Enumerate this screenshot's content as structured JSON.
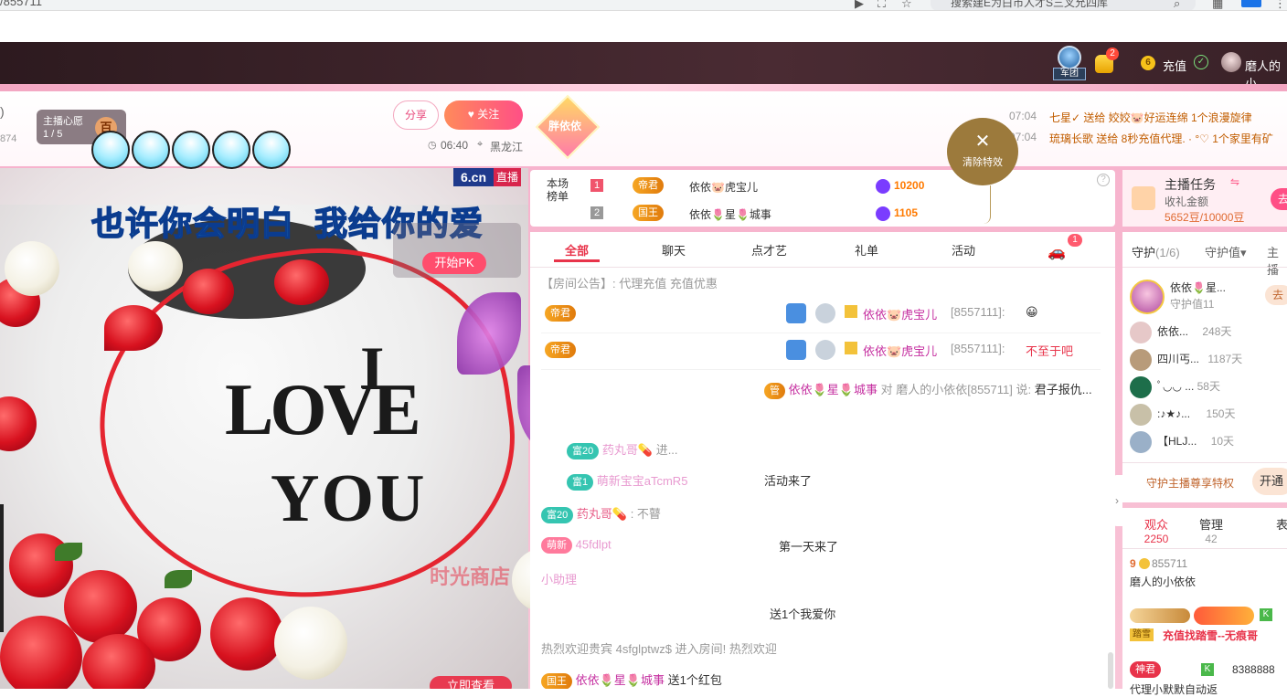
{
  "browser": {
    "url": "/855711",
    "tab_title": "搜索建E为白市人才S三叉允四库"
  },
  "header": {
    "legion_label": "军团",
    "notif_count": "2",
    "coin_icon_text": "6",
    "recharge_label": "充值",
    "user_name": "磨人的小"
  },
  "anchor": {
    "close_paren": ")",
    "fans": "874",
    "wish_label": "主播心愿",
    "wish_progress": "1 / 5",
    "wish_badge": "百"
  },
  "actions": {
    "share_label": "分享",
    "follow_label": "关注"
  },
  "live_meta": {
    "time": "06:40",
    "location": "黑龙江",
    "fan_badge": "胖依依"
  },
  "marquee": [
    {
      "time": "07:04",
      "text": "七星✓ 送给 姣姣🐷好运连绵 1个浪漫旋律"
    },
    {
      "time": "07:04",
      "text": "琉璃长歌 送给 8秒充值代理.  ·  °♡ 1个家里有矿"
    }
  ],
  "clear_effects": {
    "label": "清除特效",
    "icon": "close-icon"
  },
  "video": {
    "logo": "6.cn",
    "live_label": "直播",
    "caption": "也许你会明白  我给你的爱",
    "pk_button": "开始PK",
    "love_text_1": "I",
    "love_text_2": "LOVE",
    "love_text_3": "YOU",
    "shop_text": "时光商店",
    "view_now": "立即查看"
  },
  "rank": {
    "label": "本场榜单",
    "rows": [
      {
        "num": "1",
        "title": "帝君",
        "name": "依依🐷虎宝儿",
        "score": "10200"
      },
      {
        "num": "2",
        "title": "国王",
        "name": "依依🌷星🌷城事",
        "score": "1105"
      }
    ]
  },
  "chat": {
    "tabs": [
      "全部",
      "聊天",
      "点才艺",
      "礼单",
      "活动"
    ],
    "car_count": "1",
    "announcement": "【房间公告】: 代理充值 充值优惠",
    "messages": [
      {
        "badge": "帝君",
        "name": "依依🐷虎宝儿",
        "uid": "[8557111]:",
        "text": "😀"
      },
      {
        "badge": "帝君",
        "name": "依依🐷虎宝儿",
        "uid": "[8557111]:",
        "text": "不至于吧"
      },
      {
        "badge": "管",
        "name": "依依🌷星🌷城事",
        "uid": "对 磨人的小依依[855711] 说:",
        "text": "君子报仇..."
      },
      {
        "badge": "富20",
        "name": "药丸哥💊",
        "uid": "",
        "text": "进..."
      },
      {
        "badge": "富1",
        "name": "萌新宝宝aTcmR5",
        "uid": "",
        "text": "活动来了"
      },
      {
        "badge": "富20",
        "name": "药丸哥💊",
        "uid": "",
        "text": ": 不瞽"
      },
      {
        "badge": "萌新",
        "name": "45fdlpt",
        "uid": "",
        "text": "第一天来了"
      },
      {
        "badge": "小助理",
        "name": "",
        "uid": "",
        "text": "送1个我爱你"
      },
      {
        "badge": "",
        "name": "热烈欢迎贵宾 4sfglptwz$",
        "uid": "",
        "text": "进入房间! 热烈欢迎"
      },
      {
        "badge": "国王",
        "name": "依依🌷星🌷城事",
        "uid": "",
        "text": "送1个红包"
      }
    ]
  },
  "task": {
    "title": "主播任务",
    "subtitle": "收礼金额",
    "progress": "5652豆/10000豆",
    "go_label": "去"
  },
  "guard": {
    "tab_guard": "守护",
    "tab_count": "(1/6)",
    "tab_value": "守护值▾",
    "tab_host": "主播",
    "top_name": "依依🌷星...",
    "top_value": "守护值11",
    "top_btn": "去",
    "rows": [
      {
        "name": "依依...",
        "days": "248天"
      },
      {
        "name": "四川丐...",
        "days": "1187天"
      },
      {
        "name": "ﾟ◡◡ ...",
        "days": "58天"
      },
      {
        "name": ":♪★♪...",
        "days": "150天"
      },
      {
        "name": "【HLJ...",
        "days": "10天"
      }
    ],
    "privilege": "守护主播尊享特权",
    "open_btn": "开通"
  },
  "audience": {
    "tab_viewers": "观众",
    "viewers_count": "2250",
    "tab_admin": "管理",
    "admin_count": "42",
    "tab_more": "表",
    "entries": [
      {
        "uid": "855711",
        "name": "磨人的小依依"
      },
      {
        "uid": "",
        "name": "充值找踏雪--无痕哥",
        "tag": "踏雪"
      },
      {
        "uid": "8388888",
        "name": "代理小默默自动返",
        "tag": "神君"
      }
    ]
  },
  "colors": {
    "accent": "#ff5a8a",
    "header_bg": "#3a2228",
    "pink": "#f7b3cd",
    "score_purple": "#7a3cff",
    "score_orange": "#ff7a00"
  }
}
